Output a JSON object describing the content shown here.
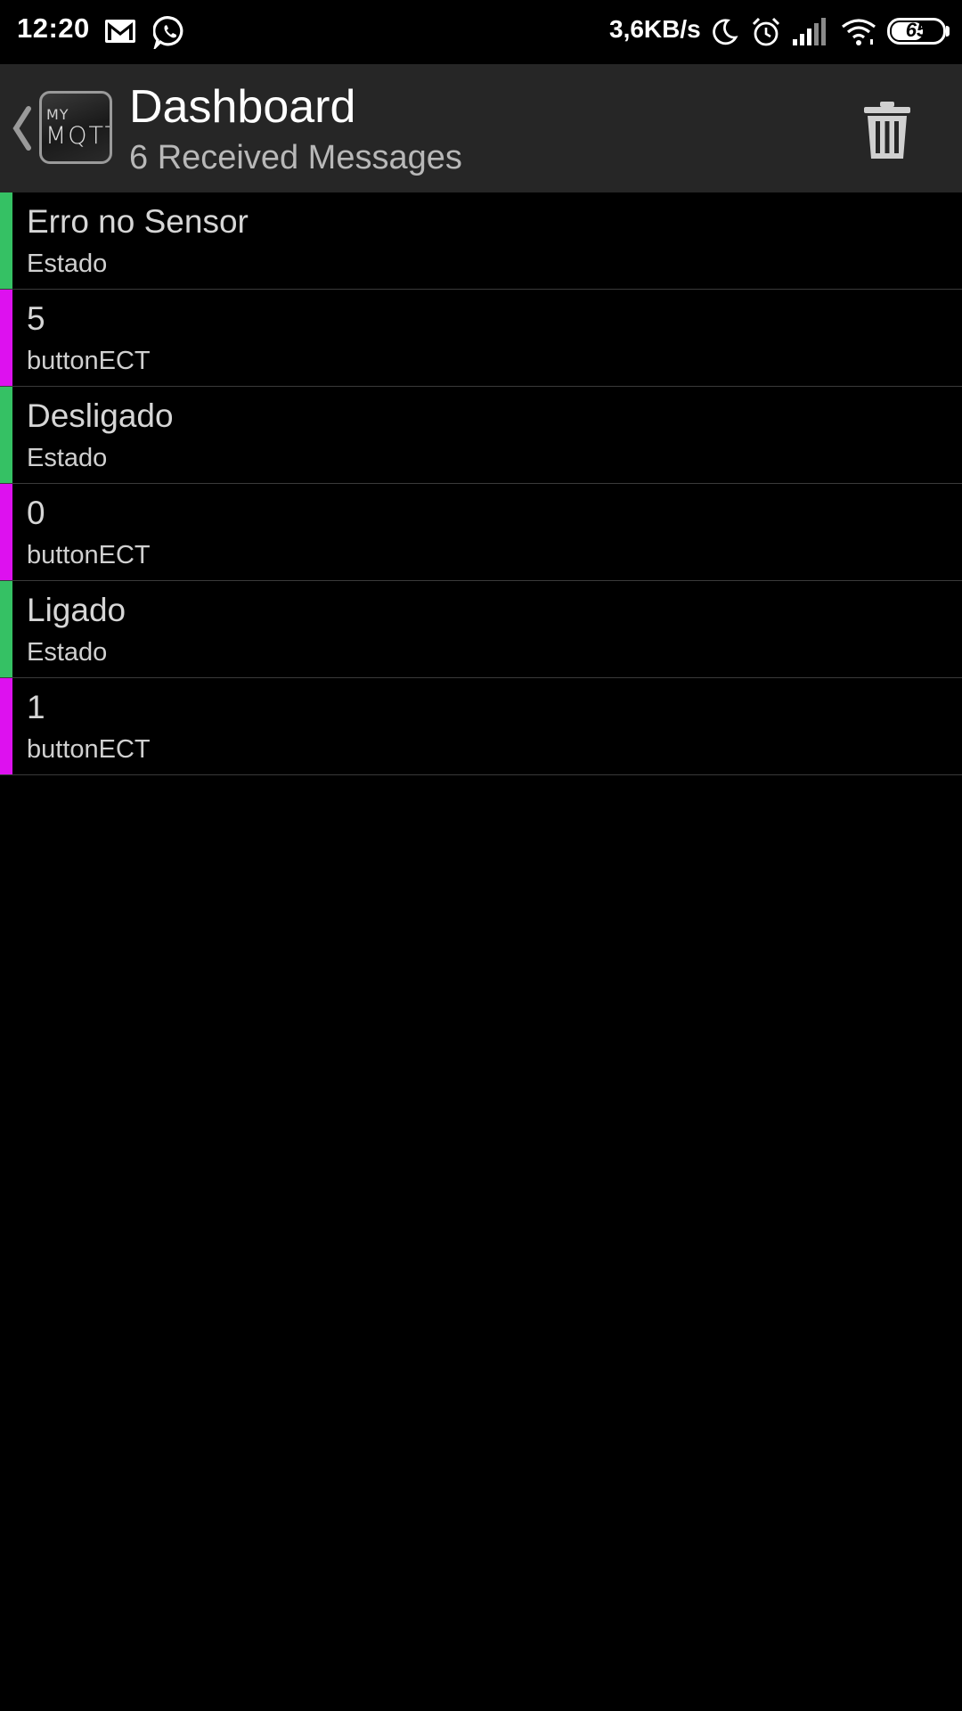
{
  "status_bar": {
    "time": "12:20",
    "speed": "3,6KB/s",
    "battery_level": 65,
    "battery_label": "65",
    "icons": [
      "gmail-icon",
      "whatsapp-icon",
      "moon-icon",
      "alarm-icon",
      "signal-icon",
      "wifi-icon",
      "battery-icon"
    ]
  },
  "header": {
    "back_icon": "chevron-left-icon",
    "logo_top": "MY",
    "logo_main": "MQTT",
    "title": "Dashboard",
    "subtitle": "6 Received Messages",
    "delete_icon": "trash-icon"
  },
  "colors": {
    "estado": "#35c164",
    "button": "#dd11ef",
    "header_bg": "#262626",
    "background": "#000000"
  },
  "messages": [
    {
      "payload": "Erro no Sensor",
      "topic": "Estado",
      "color": "#35c164"
    },
    {
      "payload": "5",
      "topic": "buttonECT",
      "color": "#dd11ef"
    },
    {
      "payload": "Desligado",
      "topic": "Estado",
      "color": "#35c164"
    },
    {
      "payload": "0",
      "topic": "buttonECT",
      "color": "#dd11ef"
    },
    {
      "payload": "Ligado",
      "topic": "Estado",
      "color": "#35c164"
    },
    {
      "payload": "1",
      "topic": "buttonECT",
      "color": "#dd11ef"
    }
  ]
}
